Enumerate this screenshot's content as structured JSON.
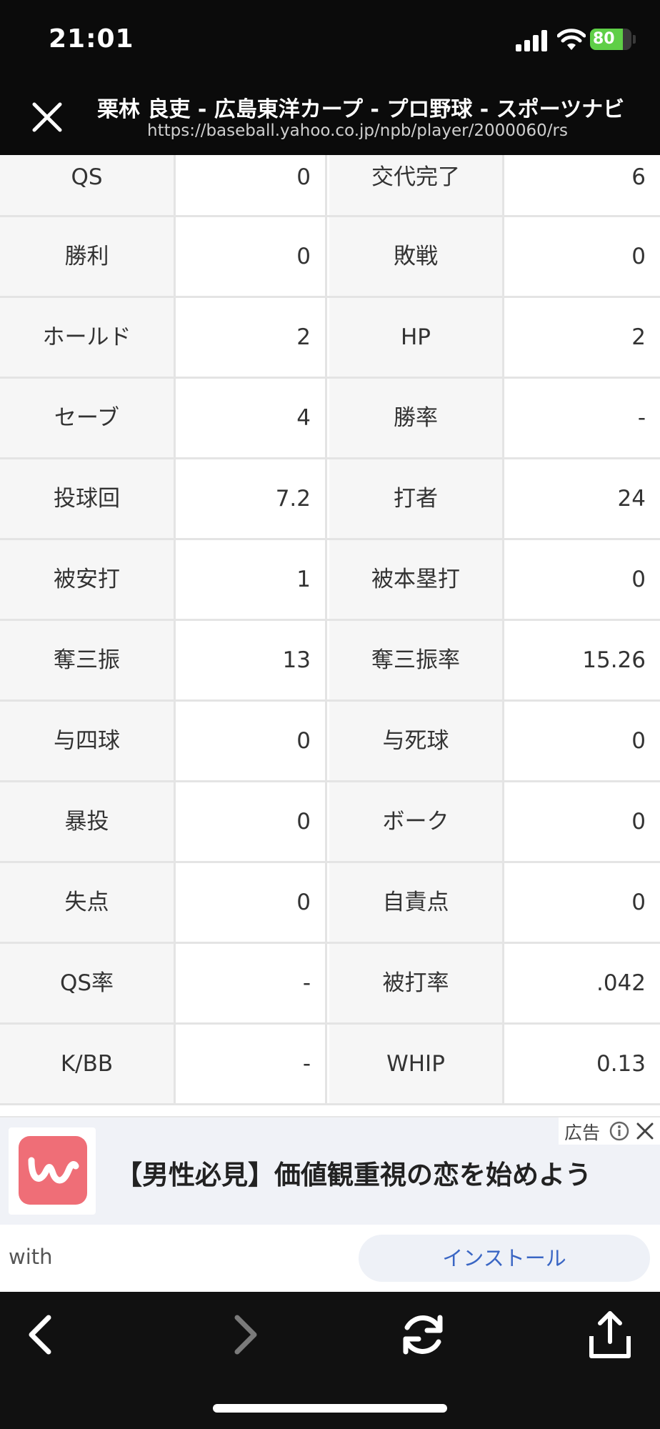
{
  "status_bar": {
    "time": "21:01",
    "battery_level": "80",
    "battery_fraction": 0.8,
    "battery_color": "#5fcf47"
  },
  "header": {
    "title": "栗林 良吏 - 広島東洋カープ - プロ野球 - スポーツナビ",
    "url": "https://baseball.yahoo.co.jp/npb/player/2000060/rs"
  },
  "stats": [
    {
      "label1": "QS",
      "value1": "0",
      "label2": "交代完了",
      "value2": "6"
    },
    {
      "label1": "勝利",
      "value1": "0",
      "label2": "敗戦",
      "value2": "0"
    },
    {
      "label1": "ホールド",
      "value1": "2",
      "label2": "HP",
      "value2": "2"
    },
    {
      "label1": "セーブ",
      "value1": "4",
      "label2": "勝率",
      "value2": "-"
    },
    {
      "label1": "投球回",
      "value1": "7.2",
      "label2": "打者",
      "value2": "24"
    },
    {
      "label1": "被安打",
      "value1": "1",
      "label2": "被本塁打",
      "value2": "0"
    },
    {
      "label1": "奪三振",
      "value1": "13",
      "label2": "奪三振率",
      "value2": "15.26"
    },
    {
      "label1": "与四球",
      "value1": "0",
      "label2": "与死球",
      "value2": "0"
    },
    {
      "label1": "暴投",
      "value1": "0",
      "label2": "ボーク",
      "value2": "0"
    },
    {
      "label1": "失点",
      "value1": "0",
      "label2": "自責点",
      "value2": "0"
    },
    {
      "label1": "QS率",
      "value1": "-",
      "label2": "被打率",
      "value2": ".042"
    },
    {
      "label1": "K/BB",
      "value1": "-",
      "label2": "WHIP",
      "value2": "0.13"
    }
  ],
  "ad": {
    "label": "広告",
    "headline": "【男性必見】価値観重視の恋を始めよう",
    "brand": "with",
    "cta": "インストール",
    "icon_color": "#ef6e77",
    "info_icon": "info-icon",
    "close_icon": "close-icon"
  },
  "toolbar": {
    "icons": [
      "back-icon",
      "forward-icon",
      "reload-icon",
      "share-icon"
    ]
  }
}
